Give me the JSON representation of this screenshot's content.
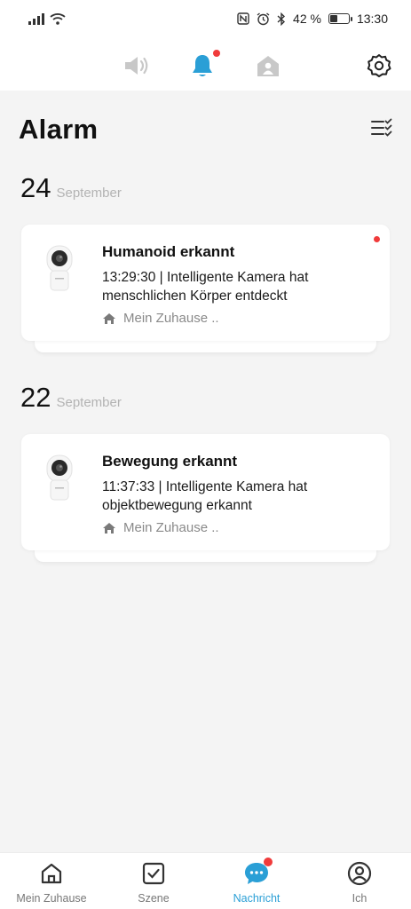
{
  "status_bar": {
    "battery_percent": "42 %",
    "time": "13:30",
    "battery_level": 0.42
  },
  "top_bar": {
    "icons": [
      "speaker-icon",
      "bell-icon",
      "home-person-icon",
      "settings-icon"
    ],
    "active_color": "#2a9fd6",
    "badge_color": "#f03b3b"
  },
  "page": {
    "title": "Alarm"
  },
  "groups": [
    {
      "day": "24",
      "month": "September",
      "events": [
        {
          "title": "Humanoid erkannt",
          "description": "13:29:30 | Intelligente Kamera hat menschlichen Körper entdeckt",
          "location": "Mein Zuhause ..",
          "unread": true
        }
      ]
    },
    {
      "day": "22",
      "month": "September",
      "events": [
        {
          "title": "Bewegung erkannt",
          "description": "11:37:33 | Intelligente Kamera hat objektbewegung erkannt",
          "location": "Mein Zuhause ..",
          "unread": false
        }
      ]
    }
  ],
  "bottom_nav": {
    "items": [
      {
        "label": "Mein Zuhause",
        "icon": "home-icon"
      },
      {
        "label": "Szene",
        "icon": "checkbox-icon"
      },
      {
        "label": "Nachricht",
        "icon": "chat-icon",
        "active": true
      },
      {
        "label": "Ich",
        "icon": "profile-icon"
      }
    ]
  }
}
